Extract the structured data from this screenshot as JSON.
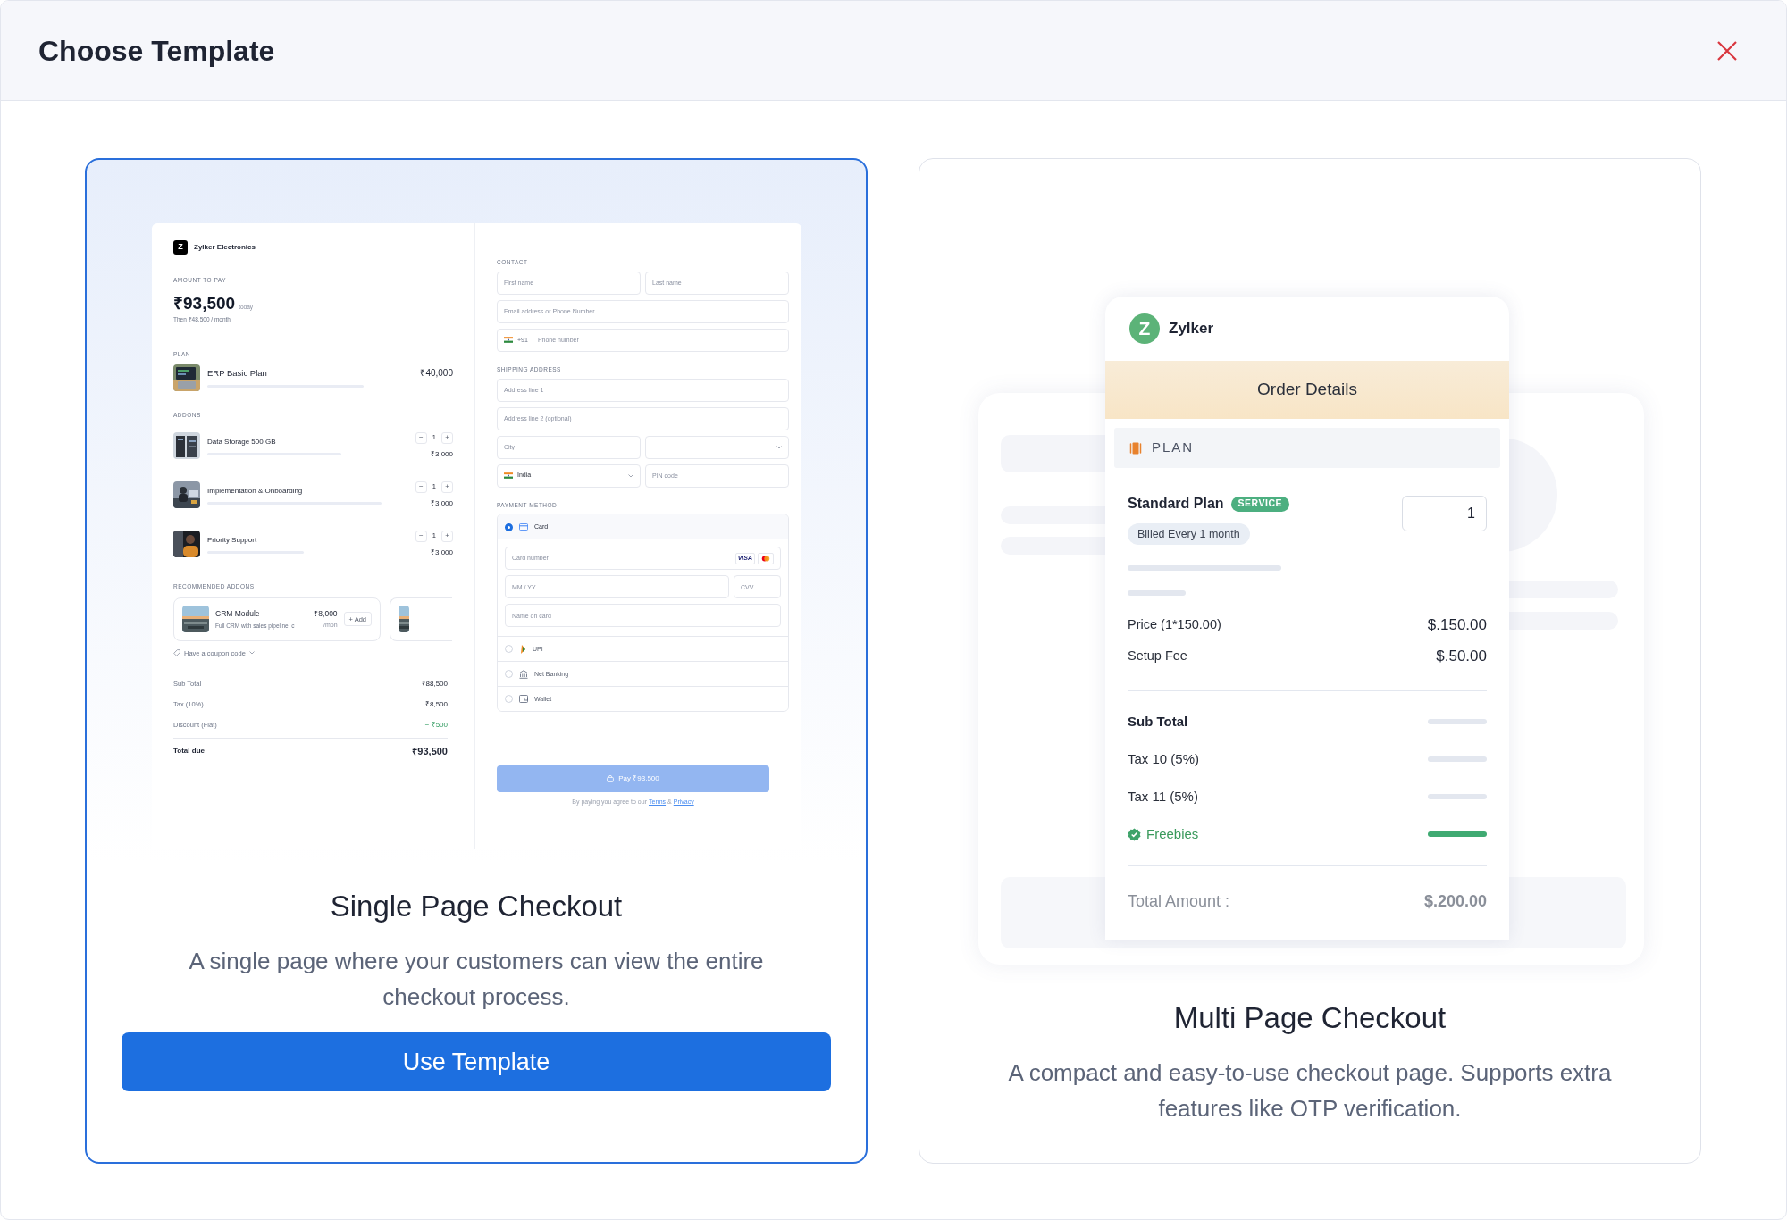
{
  "dialog": {
    "title": "Choose Template"
  },
  "templates": [
    {
      "kind": "single_page",
      "selected": true,
      "title": "Single Page Checkout",
      "description": "A single page where your customers can view the entire checkout process.",
      "button": "Use Template",
      "preview": {
        "brand_initial": "Z",
        "brand": "Zylker Electronics",
        "amount_label": "AMOUNT TO PAY",
        "amount": "₹93,500",
        "amount_suffix": "today",
        "recurring": "Then ₹48,500 / month",
        "plan_label": "PLAN",
        "plan": {
          "name": "ERP Basic Plan",
          "price": "₹40,000"
        },
        "addons_label": "ADDONS",
        "addons": [
          {
            "name": "Data Storage 500 GB",
            "decrement": "−",
            "quantity": "1",
            "increment": "+",
            "price": "₹3,000"
          },
          {
            "name": "Implementation & Onboarding",
            "decrement": "−",
            "quantity": "1",
            "increment": "+",
            "price": "₹3,000"
          },
          {
            "name": "Priority Support",
            "decrement": "−",
            "quantity": "1",
            "increment": "+",
            "price": "₹3,000"
          }
        ],
        "recommended_label": "RECOMMENDED ADDONS",
        "recommended": {
          "name": "CRM Module",
          "description": "Full CRM with sales pipeline, c",
          "price": "₹8,000",
          "period": "/mon",
          "button": "+ Add"
        },
        "more_recommended": true,
        "coupon": "Have a coupon code",
        "summary": [
          {
            "kind": "normal",
            "label": "Sub Total",
            "value": "₹88,500"
          },
          {
            "kind": "normal",
            "label": "Tax (10%)",
            "value": "₹8,500"
          },
          {
            "kind": "discount",
            "label": "Discount (Flat)",
            "value": "− ₹500"
          }
        ],
        "total": {
          "label": "Total due",
          "value": "₹93,500"
        },
        "contact": {
          "label": "CONTACT",
          "rows": [
            [
              {
                "kind": "text",
                "placeholder": "First name"
              },
              {
                "kind": "text",
                "placeholder": "Last name"
              }
            ],
            [
              {
                "kind": "text",
                "placeholder": "Email address or Phone Number"
              }
            ],
            [
              {
                "kind": "phone",
                "code": "+91",
                "placeholder": "Phone number"
              }
            ]
          ]
        },
        "shipping": {
          "label": "SHIPPING ADDRESS",
          "rows": [
            [
              {
                "kind": "text",
                "placeholder": "Address line 1"
              }
            ],
            [
              {
                "kind": "text",
                "placeholder": "Address line 2 (optional)"
              }
            ],
            [
              {
                "kind": "text",
                "placeholder": "City"
              },
              {
                "kind": "select"
              }
            ],
            [
              {
                "kind": "country",
                "value": "India"
              },
              {
                "kind": "text",
                "placeholder": "PIN code"
              }
            ]
          ]
        },
        "payment": {
          "label": "PAYMENT METHOD",
          "methods": [
            {
              "kind": "card",
              "label": "Card",
              "selected": true,
              "card_brand": "VISA",
              "fields": [
                {
                  "placeholder": "Card number"
                },
                {
                  "placeholder": "MM / YY"
                },
                {
                  "placeholder": "CVV"
                },
                {
                  "placeholder": "Name on card"
                }
              ]
            },
            {
              "kind": "upi",
              "label": "UPI",
              "selected": false
            },
            {
              "kind": "bank",
              "label": "Net Banking",
              "selected": false
            },
            {
              "kind": "wallet",
              "label": "Wallet",
              "selected": false
            }
          ]
        },
        "pay_button": "Pay ₹93,500",
        "legal": {
          "text": "By paying you agree to our",
          "terms": "Terms",
          "joiner": "&",
          "privacy": "Privacy"
        }
      }
    },
    {
      "kind": "multi_page",
      "selected": false,
      "title": "Multi Page Checkout",
      "description": "A compact and easy-to-use checkout page. Supports extra features like OTP verification.",
      "preview": {
        "brand_initial": "Z",
        "brand": "Zylker",
        "heading": "Order Details",
        "section": "PLAN",
        "plan": {
          "name": "Standard Plan",
          "badge": "SERVICE",
          "billing": "Billed Every 1 month",
          "quantity": "1"
        },
        "charges": [
          {
            "label": "Price (1*150.00)",
            "value": "$.150.00"
          },
          {
            "label": "Setup Fee",
            "value": "$.50.00"
          }
        ],
        "totals": [
          {
            "kind": "subtotal",
            "label": "Sub Total"
          },
          {
            "kind": "tax",
            "label": "Tax 10 (5%)"
          },
          {
            "kind": "tax",
            "label": "Tax 11 (5%)"
          },
          {
            "kind": "freebie",
            "label": "Freebies"
          }
        ],
        "total": {
          "label": "Total Amount :",
          "value": "$.200.00"
        }
      }
    }
  ]
}
